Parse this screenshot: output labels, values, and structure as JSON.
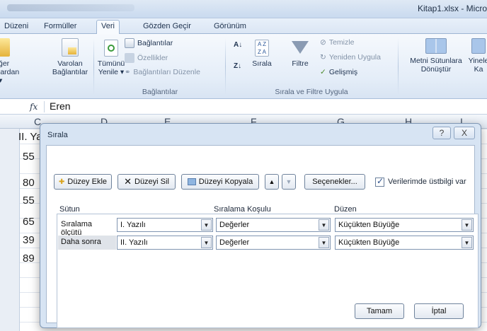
{
  "window": {
    "title": "Kitap1.xlsx - Micro"
  },
  "ribbon_tabs": [
    "Düzeni",
    "Formüller",
    "Veri",
    "Gözden Geçir",
    "Görünüm"
  ],
  "ribbon": {
    "left_partial_1": "ğer",
    "left_partial_2": "lardan ▾",
    "existing_conn_1": "Varolan",
    "existing_conn_2": "Bağlantılar",
    "refresh_1": "Tümünü",
    "refresh_2": "Yenile ▾",
    "connections": "Bağlantılar",
    "properties": "Özellikler",
    "edit_links": "Bağlantıları Düzenle",
    "group_connections": "Bağlantılar",
    "sort_az": "A↓Z",
    "sort_label": "Sırala",
    "filter_label": "Filtre",
    "clear": "Temizle",
    "reapply": "Yeniden Uygula",
    "advanced": "Gelişmiş",
    "group_sort_filter": "Sırala ve Filtre Uygula",
    "text_to_columns_1": "Metni Sütunlara",
    "text_to_columns_2": "Dönüştür",
    "remove_dup_1": "Yinele",
    "remove_dup_2": "Ka"
  },
  "formula_bar": {
    "fx": "fx",
    "value": "Eren"
  },
  "sheet": {
    "columns": [
      "C",
      "D",
      "E",
      "F",
      "G",
      "H",
      "I"
    ],
    "cell_header": "II. Ya",
    "cells": [
      "55",
      "80",
      "55",
      "65",
      "39",
      "89"
    ]
  },
  "dialog": {
    "title": "Sırala",
    "help": "?",
    "close": "X",
    "add_level": "Düzey Ekle",
    "delete_level": "Düzeyi Sil",
    "copy_level": "Düzeyi Kopyala",
    "up": "▲",
    "down": "▼",
    "options": "Seçenekler...",
    "has_headers": "Verilerimde üstbilgi var",
    "col_header": "Sütun",
    "sorton_header": "Sıralama Koşulu",
    "order_header": "Düzen",
    "levels": [
      {
        "label": "Sıralama ölçütü",
        "column": "I. Yazılı",
        "sort_on": "Değerler",
        "order": "Küçükten Büyüğe"
      },
      {
        "label": "Daha sonra",
        "column": "II. Yazılı",
        "sort_on": "Değerler",
        "order": "Küçükten Büyüğe"
      }
    ],
    "ok": "Tamam",
    "cancel": "İptal"
  },
  "colors": {
    "accent": "#2b579a",
    "ribbon_bg": "#e4edf8",
    "dialog_bg": "#d7e4f3"
  }
}
